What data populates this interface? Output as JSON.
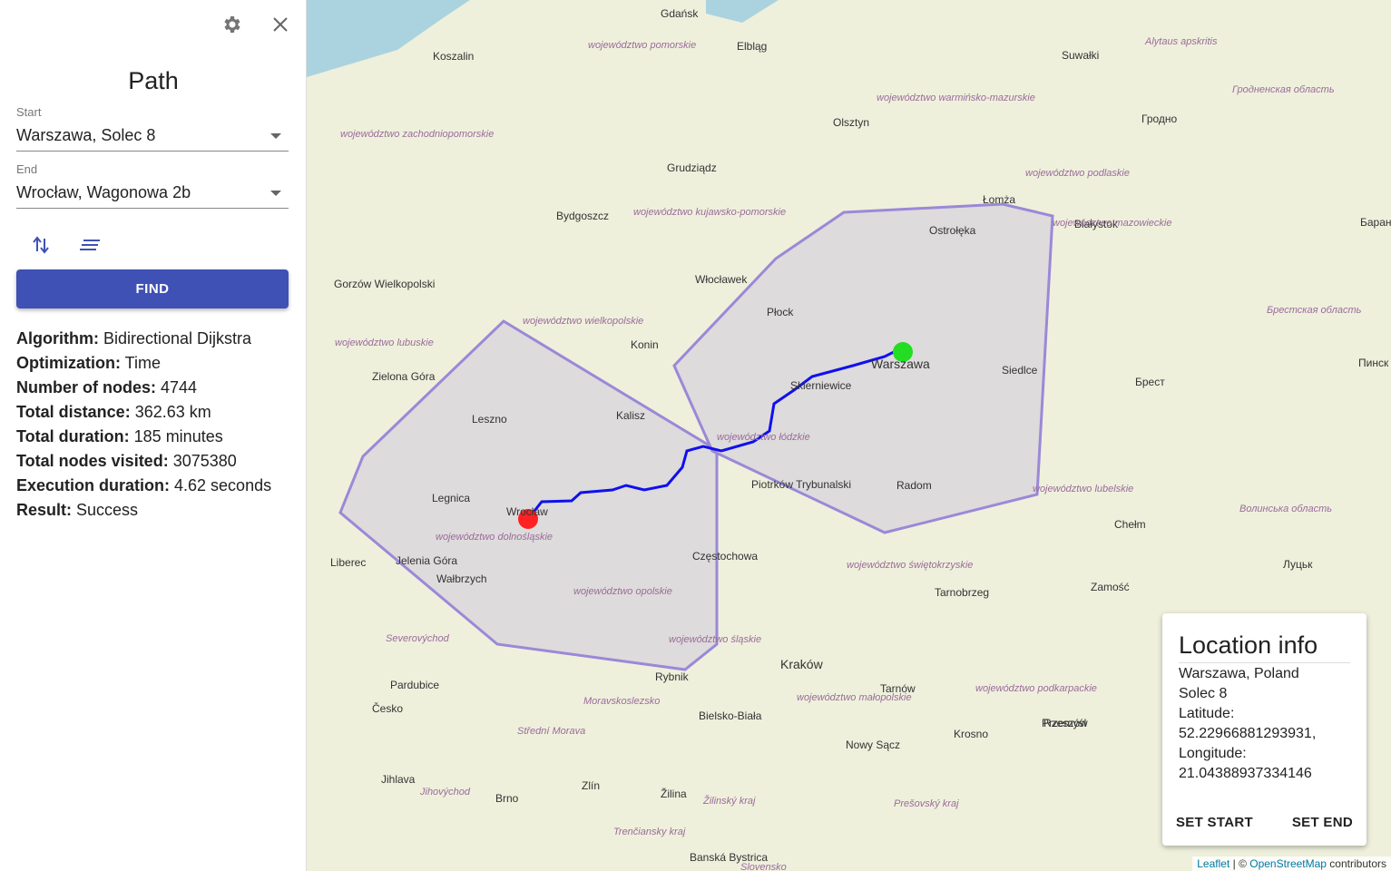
{
  "panel": {
    "title": "Path",
    "start": {
      "label": "Start",
      "value": "Warszawa,  Solec 8"
    },
    "end": {
      "label": "End",
      "value": "Wrocław,  Wagonowa 2b"
    },
    "find_label": "FIND",
    "stats": [
      {
        "k": "Algorithm:",
        "v": " Bidirectional Dijkstra"
      },
      {
        "k": "Optimization:",
        "v": " Time"
      },
      {
        "k": "Number of nodes:",
        "v": " 4744"
      },
      {
        "k": "Total distance:",
        "v": " 362.63 km"
      },
      {
        "k": "Total duration:",
        "v": " 185 minutes"
      },
      {
        "k": "Total nodes visited:",
        "v": " 3075380"
      },
      {
        "k": "Execution duration:",
        "v": " 4.62 seconds"
      },
      {
        "k": "Result:",
        "v": " Success"
      }
    ]
  },
  "colors": {
    "accent": "#3f51b5",
    "route": "#1010ee",
    "polygon": "#9b88d8",
    "start_marker": "#22dd22",
    "end_marker": "#ff2222"
  },
  "map": {
    "labels": [
      "Gdańsk",
      "Koszalin",
      "Elbląg",
      "Suwałki",
      "Olsztyn",
      "Grudziądz",
      "Bydgoszcz",
      "Łomża",
      "Białystok",
      "Ostrołęka",
      "Włocławek",
      "Płock",
      "Konin",
      "Warszawa",
      "Siedlce",
      "Skierniewice",
      "Kalisz",
      "Leszno",
      "Zielona Góra",
      "Gorzów Wielkopolski",
      "Legnica",
      "Wrocław",
      "Radom",
      "Piotrków Trybunalski",
      "Częstochowa",
      "Chełm",
      "Zamość",
      "Tarnobrzeg",
      "Kraków",
      "Tarnów",
      "Rzeszów",
      "Przemyśl",
      "Krosno",
      "Nowy Sącz",
      "Bielsko-Biała",
      "Rybnik",
      "Wałbrzych",
      "Jelenia Góra",
      "Liberec",
      "Pardubice",
      "Česko",
      "Jihlava",
      "Brno",
      "Zlín",
      "Žilina",
      "Banská Bystrica",
      "Гродно",
      "Брест",
      "Луцьк",
      "Пинск",
      "Барановичи"
    ],
    "regions": [
      "województwo pomorskie",
      "województwo warmińsko-mazurskie",
      "województwo podlaskie",
      "województwo zachodniopomorskie",
      "województwo kujawsko-pomorskie",
      "województwo wielkopolskie",
      "województwo lubuskie",
      "województwo łódzkie",
      "województwo mazowieckie",
      "województwo lubelskie",
      "województwo dolnośląskie",
      "województwo opolskie",
      "województwo śląskie",
      "województwo świętokrzyskie",
      "województwo małopolskie",
      "województwo podkarpackie",
      "Alytaus apskritis",
      "Гродненская область",
      "Брестская область",
      "Волинська область",
      "Severovýchod",
      "Moravskoslezsko",
      "Střední Morava",
      "Jihovýchod",
      "Žilinský kraj",
      "Prešovský kraj",
      "Trenčiansky kraj",
      "Slovensko"
    ]
  },
  "info": {
    "title": "Location info",
    "lines": [
      "Warszawa, Poland",
      "Solec 8",
      "Latitude:",
      "52.22966881293931,",
      "Longitude:",
      "21.04388937334146"
    ],
    "set_start": "SET START",
    "set_end": "SET END"
  },
  "attribution": {
    "leaflet": "Leaflet",
    "sep": " | © ",
    "osm": "OpenStreetMap",
    "rest": " contributors"
  }
}
